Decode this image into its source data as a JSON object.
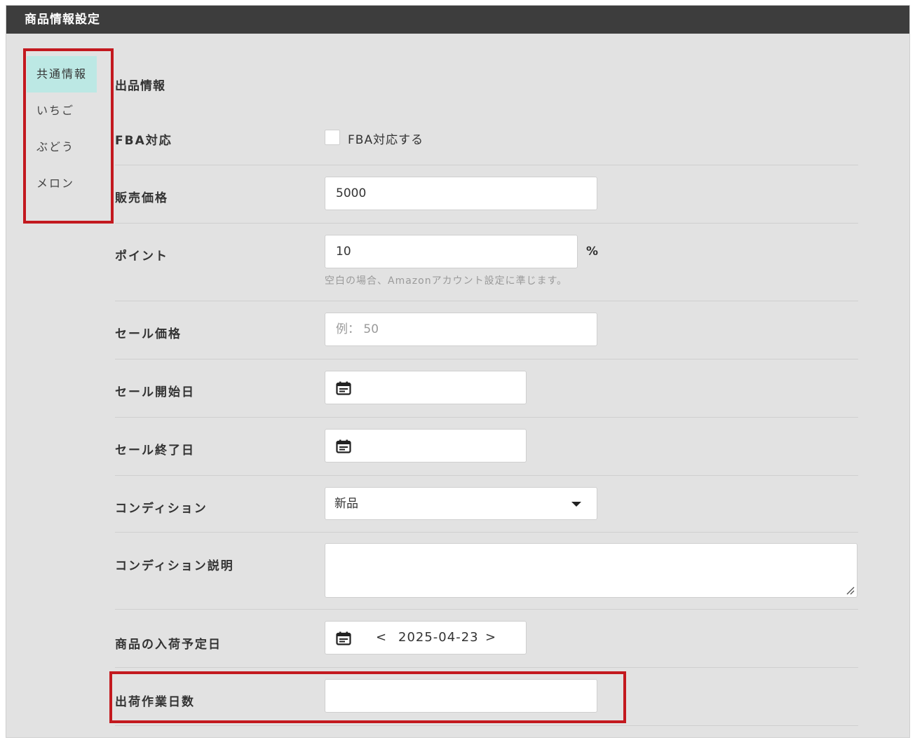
{
  "header": {
    "title": "商品情報設定"
  },
  "sidebar": {
    "items": [
      {
        "label": "共通情報",
        "active": true
      },
      {
        "label": "いちご",
        "active": false
      },
      {
        "label": "ぶどう",
        "active": false
      },
      {
        "label": "メロン",
        "active": false
      }
    ]
  },
  "section": {
    "title": "出品情報"
  },
  "fields": {
    "fba": {
      "label": "FBA対応",
      "checkbox_label": "FBA対応する",
      "checked": false
    },
    "price": {
      "label": "販売価格",
      "value": "5000"
    },
    "point": {
      "label": "ポイント",
      "value": "10",
      "unit": "%",
      "hint": "空白の場合、Amazonアカウント設定に準じます。"
    },
    "sale_price": {
      "label": "セール価格",
      "placeholder": "例： 50"
    },
    "sale_start": {
      "label": "セール開始日",
      "value": ""
    },
    "sale_end": {
      "label": "セール終了日",
      "value": ""
    },
    "condition": {
      "label": "コンディション",
      "value": "新品"
    },
    "condition_note": {
      "label": "コンディション説明",
      "value": ""
    },
    "arrival_date": {
      "label": "商品の入荷予定日",
      "value": "2025-04-23",
      "prev": "<",
      "next": ">"
    },
    "shipping_days": {
      "label": "出荷作業日数",
      "value": ""
    }
  },
  "colors": {
    "header_bg": "#3d3d3d",
    "active_tab": "#bce8e4",
    "highlight": "#c3191f",
    "panel_bg": "#e2e2e2"
  }
}
